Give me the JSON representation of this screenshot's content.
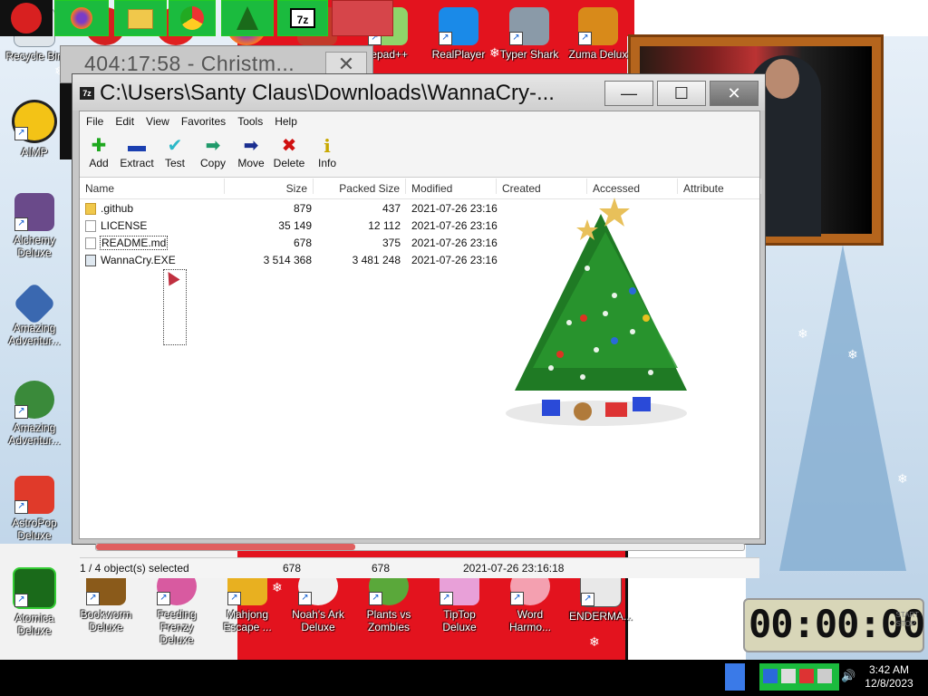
{
  "desktop": {
    "icons_left": [
      {
        "label": "Recycle Bin"
      },
      {
        "label": "AIMP"
      },
      {
        "label": "Alchemy Deluxe"
      },
      {
        "label": "Amazing Adventur..."
      },
      {
        "label": "Amazing Adventur..."
      },
      {
        "label": "AstroPop Deluxe"
      }
    ],
    "icons_top": [
      {
        "label": "tepad++"
      },
      {
        "label": "RealPlayer"
      },
      {
        "label": "Typer Shark"
      },
      {
        "label": "Zuma Delux"
      }
    ],
    "icons_bottom": [
      {
        "label": "Atomica Deluxe"
      },
      {
        "label": "Bookworm Deluxe"
      },
      {
        "label": "Feeding Frenzy Deluxe"
      },
      {
        "label": "Mahjong Escape ..."
      },
      {
        "label": "Noah's Ark Deluxe"
      },
      {
        "label": "Plants vs Zombies"
      },
      {
        "label": "TipTop Deluxe"
      },
      {
        "label": "Word Harmo..."
      },
      {
        "label": "ENDERMA..."
      }
    ]
  },
  "background_window": {
    "title": "404:17:58 - Christm...",
    "close_glyph": "✕"
  },
  "window": {
    "app_icon": "7z",
    "title": "C:\\Users\\Santy Claus\\Downloads\\WannaCry-...",
    "minimize_glyph": "—",
    "maximize_glyph": "☐",
    "close_glyph": "✕",
    "menu": [
      "File",
      "Edit",
      "View",
      "Favorites",
      "Tools",
      "Help"
    ],
    "toolbar": [
      {
        "label": "Add",
        "icon": "plus-icon",
        "glyph": "✚",
        "color": "#1ea81e"
      },
      {
        "label": "Extract",
        "icon": "minus-icon",
        "glyph": "▬",
        "color": "#1a3fb0"
      },
      {
        "label": "Test",
        "icon": "check-icon",
        "glyph": "✔",
        "color": "#2cb8c8"
      },
      {
        "label": "Copy",
        "icon": "arrow-right-icon",
        "glyph": "➡",
        "color": "#1f9a6a"
      },
      {
        "label": "Move",
        "icon": "arrow-right-icon",
        "glyph": "➡",
        "color": "#1a2e90"
      },
      {
        "label": "Delete",
        "icon": "x-icon",
        "glyph": "✖",
        "color": "#d01010"
      },
      {
        "label": "Info",
        "icon": "info-icon",
        "glyph": "i",
        "color": "#c8a800"
      }
    ],
    "columns": [
      "Name",
      "Size",
      "Packed Size",
      "Modified",
      "Created",
      "Accessed",
      "Attribute"
    ],
    "files": [
      {
        "name": ".github",
        "type": "folder",
        "size": "879",
        "packed": "437",
        "modified": "2021-07-26 23:16"
      },
      {
        "name": "LICENSE",
        "type": "file",
        "size": "35 149",
        "packed": "12 112",
        "modified": "2021-07-26 23:16"
      },
      {
        "name": "README.md",
        "type": "file",
        "size": "678",
        "packed": "375",
        "modified": "2021-07-26 23:16"
      },
      {
        "name": "WannaCry.EXE",
        "type": "exe",
        "size": "3 514 368",
        "packed": "3 481 248",
        "modified": "2021-07-26 23:16"
      }
    ],
    "status": {
      "selection": "1 / 4 object(s) selected",
      "size": "678",
      "packed": "678",
      "modified": "2021-07-26 23:16:18"
    },
    "progress_fraction": 0.4
  },
  "widget_clock": {
    "digits": "00:00:00",
    "start_label": "START",
    "stop_label": "STOP"
  },
  "taskbar": {
    "time": "3:42 AM",
    "date": "12/8/2023"
  }
}
